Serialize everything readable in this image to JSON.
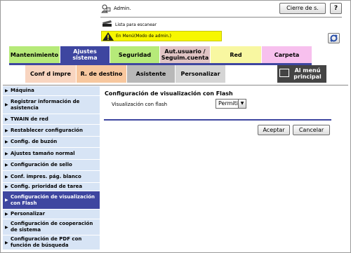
{
  "header": {
    "user_icon": "admin-user-icon",
    "user_label": "Admin.",
    "logout_label": "Cierre de s.",
    "help_label": "?",
    "scan_icon": "scanner-icon",
    "scan_label": "Lista para escanear",
    "warning_icon": "warning-triangle-icon",
    "warning_label": "En Menú(Modo de admin.)",
    "refresh_icon": "refresh-icon",
    "warning_color": "#f7f700"
  },
  "tabs_row1": [
    {
      "label": "Mantenimiento"
    },
    {
      "label": "Ajustes sistema"
    },
    {
      "label": "Seguridad"
    },
    {
      "label": "Aut.usuario / Seguim.cuenta"
    },
    {
      "label": "Red"
    },
    {
      "label": "Carpeta"
    }
  ],
  "tabs_row2": [
    {
      "label": "Conf d impre"
    },
    {
      "label": "R. de destino"
    },
    {
      "label": "Asistente"
    },
    {
      "label": "Personalizar"
    }
  ],
  "menu_button": {
    "label": "Al menú principal",
    "icon": "main-menu-icon"
  },
  "sidebar": {
    "items": [
      {
        "label": "Máquina"
      },
      {
        "label": "Registrar información de asistencia"
      },
      {
        "label": "TWAIN de red"
      },
      {
        "label": "Restablecer configuración"
      },
      {
        "label": "Config. de buzón"
      },
      {
        "label": "Ajustes tamaño normal"
      },
      {
        "label": "Configuración de sello"
      },
      {
        "label": "Conf. impres. pág. blanco"
      },
      {
        "label": "Config. prioridad de tarea"
      },
      {
        "label": "Configuración de visualización con Flash"
      },
      {
        "label": "Personalizar"
      },
      {
        "label": "Configuración de cooperación de sistema"
      },
      {
        "label": "Configuración de PDF con función de búsqueda"
      }
    ],
    "active_index": 9,
    "active_color": "#3e46a0"
  },
  "main": {
    "title": "Configuración de visualización con Flash",
    "field_label": "Visualización con flash",
    "select_value": "Permitir",
    "ok_label": "Aceptar",
    "cancel_label": "Cancelar"
  }
}
